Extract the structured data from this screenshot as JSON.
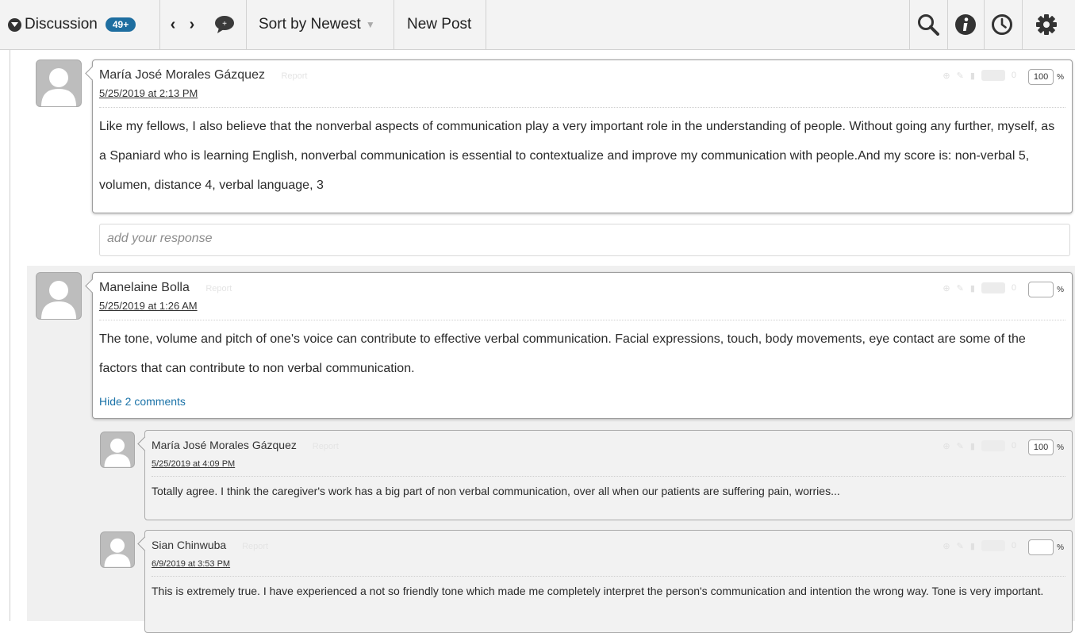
{
  "toolbar": {
    "discussion_label": "Discussion",
    "post_count_badge": "49+",
    "sort_label": "Sort by Newest",
    "new_post_label": "New Post",
    "icons": [
      "collapse-icon",
      "chevron-left-icon",
      "chevron-right-icon",
      "comment-icon",
      "search-icon",
      "info-icon",
      "clock-icon",
      "gear-icon"
    ]
  },
  "posts": [
    {
      "author": "María José Morales Gázquez",
      "report_label": "Report",
      "date": "5/25/2019 at 2:13 PM",
      "body": "Like my fellows, I also believe that the nonverbal aspects of communication play a very important role in the understanding of people. Without going any further, myself, as a Spaniard who is learning English, nonverbal communication is essential to contextualize and improve my communication with people.And my score is: non-verbal 5, volumen, distance 4, verbal language, 3",
      "score": "100",
      "percent_sign": "%"
    },
    {
      "author": "Manelaine Bolla",
      "report_label": "Report",
      "date": "5/25/2019 at 1:26 AM",
      "body": "The tone, volume and pitch of one's voice can contribute to effective verbal communication. Facial expressions, touch, body movements, eye contact are some of the factors that can contribute to non verbal communication.",
      "score": "",
      "percent_sign": "%",
      "hide_comments_label": "Hide 2 comments",
      "comments": [
        {
          "author": "María José Morales Gázquez",
          "report_label": "Report",
          "date": "5/25/2019 at 4:09 PM",
          "body": "Totally agree. I think the caregiver's work has a big part of non verbal communication, over all when our patients are suffering pain, worries...",
          "score": "100",
          "percent_sign": "%"
        },
        {
          "author": "Sian Chinwuba",
          "report_label": "Report",
          "date": "6/9/2019 at 3:53 PM",
          "body": "This is extremely true. I have experienced a not so friendly tone which made me completely interpret the person's communication and intention the wrong way. Tone is very important.",
          "score": "",
          "percent_sign": "%"
        }
      ]
    }
  ],
  "response_placeholder": "add your response",
  "colors": {
    "badge": "#1e6ea0",
    "link": "#1b73a8",
    "toolbar_bg": "#f3f3f3"
  }
}
